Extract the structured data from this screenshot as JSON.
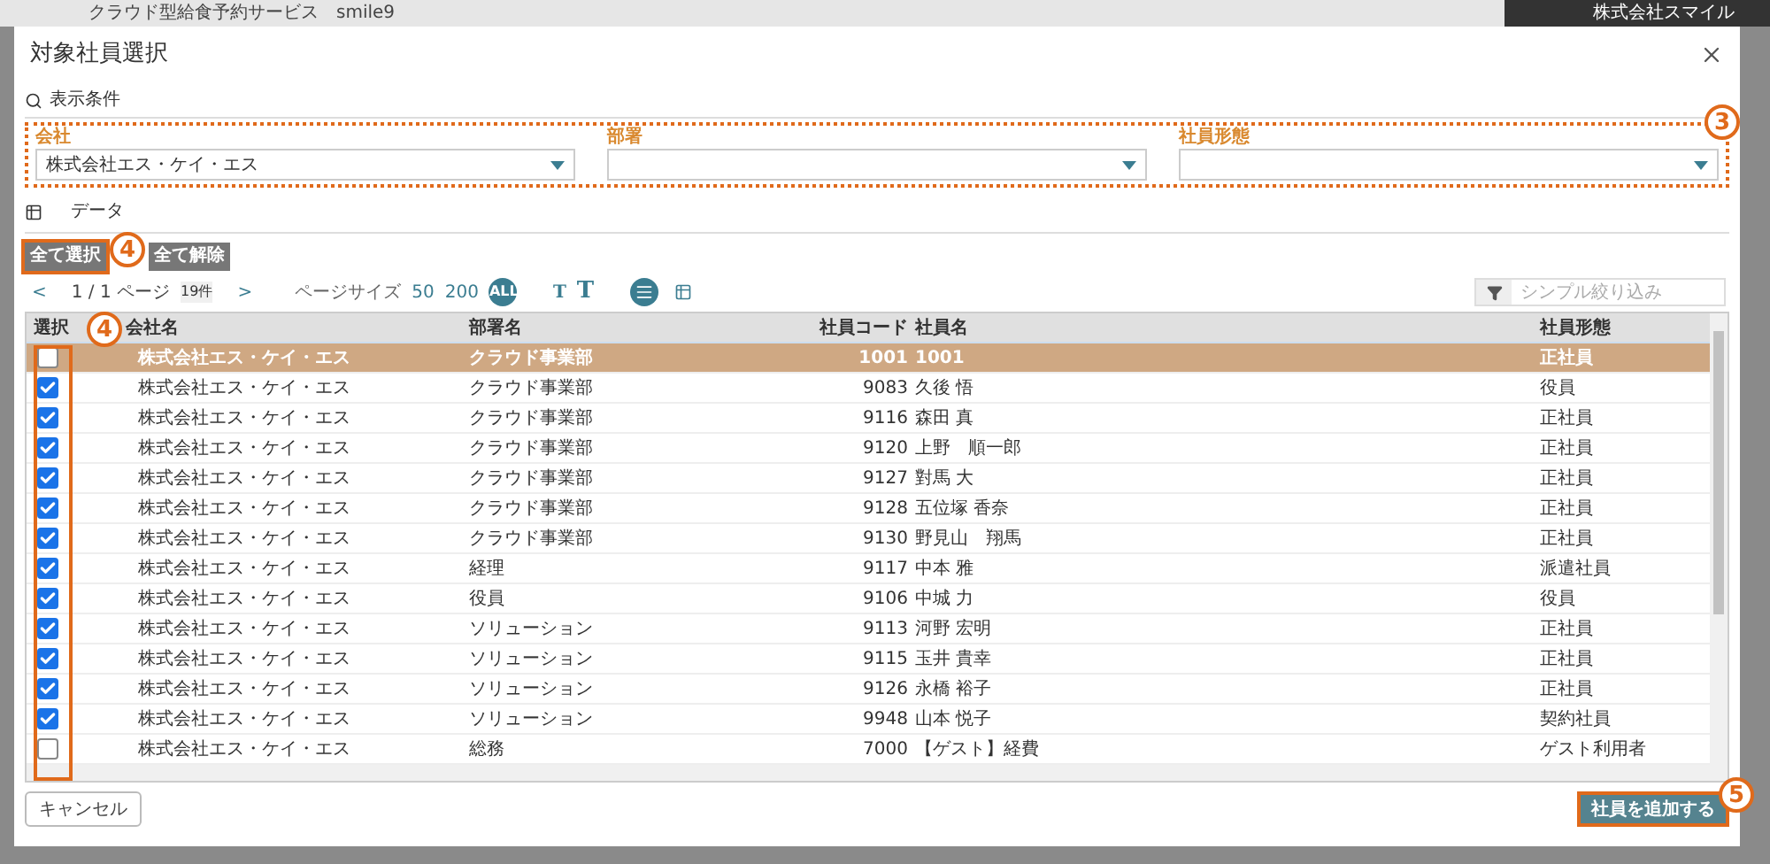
{
  "app_header": {
    "title": "クラウド型給食予約サービス　smile9",
    "user": "株式会社スマイル"
  },
  "dialog": {
    "title": "対象社員選択"
  },
  "conditions": {
    "heading": "表示条件",
    "annotation": "3",
    "filters": [
      {
        "label": "会社",
        "value": "株式会社エス・ケイ・エス"
      },
      {
        "label": "部署"
      },
      {
        "label": "社員形態"
      }
    ]
  },
  "data_section": {
    "heading": "データ"
  },
  "bulk_buttons": [
    {
      "label": "全て選択",
      "annotation": "4"
    },
    {
      "label": "全て解除"
    }
  ],
  "pagination": {
    "prev": "<",
    "page": "1 / 1 ページ",
    "count": "19件",
    "next": ">",
    "page_size_label": "ページサイズ",
    "page_sizes": [
      {
        "label": "50",
        "selected": false
      },
      {
        "label": "200",
        "selected": false
      },
      {
        "label": "ALL",
        "selected": true
      }
    ],
    "font_sizes": [
      "T",
      "T"
    ],
    "view_modes": [
      {
        "kind": "list",
        "selected": true
      },
      {
        "kind": "grid",
        "selected": false
      }
    ]
  },
  "simple_filter": {
    "placeholder": "シンプル絞り込み"
  },
  "table": {
    "columns": [
      "選択",
      "会社名",
      "部署名",
      "社員コード",
      "社員名",
      "社員形態"
    ],
    "select_annotation": "4",
    "rows": [
      {
        "checked": false,
        "selected": true,
        "company": "株式会社エス・ケイ・エス",
        "department": "クラウド事業部",
        "code": "1001",
        "name": "1001",
        "type": "正社員"
      },
      {
        "checked": true,
        "selected": false,
        "company": "株式会社エス・ケイ・エス",
        "department": "クラウド事業部",
        "code": "9083",
        "name": "久後 悟",
        "type": "役員"
      },
      {
        "checked": true,
        "selected": false,
        "company": "株式会社エス・ケイ・エス",
        "department": "クラウド事業部",
        "code": "9116",
        "name": "森田 真",
        "type": "正社員"
      },
      {
        "checked": true,
        "selected": false,
        "company": "株式会社エス・ケイ・エス",
        "department": "クラウド事業部",
        "code": "9120",
        "name": "上野　順一郎",
        "type": "正社員"
      },
      {
        "checked": true,
        "selected": false,
        "company": "株式会社エス・ケイ・エス",
        "department": "クラウド事業部",
        "code": "9127",
        "name": "對馬 大",
        "type": "正社員"
      },
      {
        "checked": true,
        "selected": false,
        "company": "株式会社エス・ケイ・エス",
        "department": "クラウド事業部",
        "code": "9128",
        "name": "五位塚 香奈",
        "type": "正社員"
      },
      {
        "checked": true,
        "selected": false,
        "company": "株式会社エス・ケイ・エス",
        "department": "クラウド事業部",
        "code": "9130",
        "name": "野見山　翔馬",
        "type": "正社員"
      },
      {
        "checked": true,
        "selected": false,
        "company": "株式会社エス・ケイ・エス",
        "department": "経理",
        "code": "9117",
        "name": "中本 雅",
        "type": "派遣社員"
      },
      {
        "checked": true,
        "selected": false,
        "company": "株式会社エス・ケイ・エス",
        "department": "役員",
        "code": "9106",
        "name": "中城 力",
        "type": "役員"
      },
      {
        "checked": true,
        "selected": false,
        "company": "株式会社エス・ケイ・エス",
        "department": "ソリューション",
        "code": "9113",
        "name": "河野 宏明",
        "type": "正社員"
      },
      {
        "checked": true,
        "selected": false,
        "company": "株式会社エス・ケイ・エス",
        "department": "ソリューション",
        "code": "9115",
        "name": "玉井 貴幸",
        "type": "正社員"
      },
      {
        "checked": true,
        "selected": false,
        "company": "株式会社エス・ケイ・エス",
        "department": "ソリューション",
        "code": "9126",
        "name": "永橋 裕子",
        "type": "正社員"
      },
      {
        "checked": true,
        "selected": false,
        "company": "株式会社エス・ケイ・エス",
        "department": "ソリューション",
        "code": "9948",
        "name": "山本 悦子",
        "type": "契約社員"
      },
      {
        "checked": false,
        "selected": false,
        "company": "株式会社エス・ケイ・エス",
        "department": "総務",
        "code": "7000",
        "name": "【ゲスト】経費",
        "type": "ゲスト利用者"
      }
    ]
  },
  "footer": {
    "cancel": "キャンセル",
    "submit": "社員を追加する",
    "submit_annotation": "5"
  }
}
